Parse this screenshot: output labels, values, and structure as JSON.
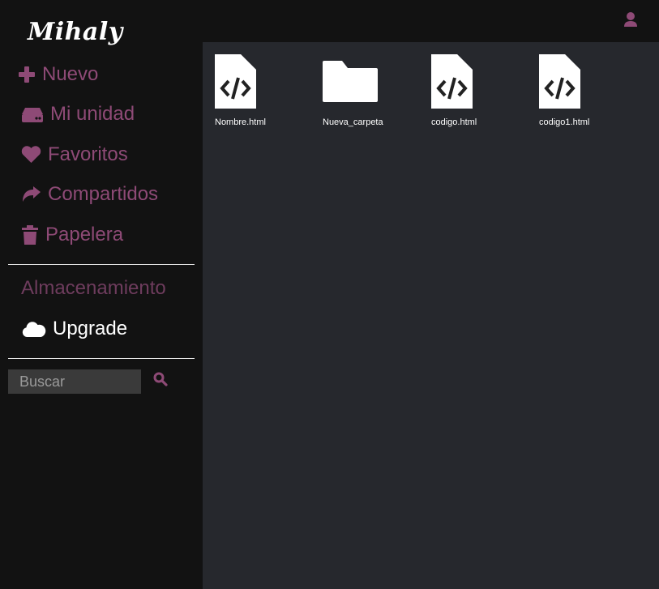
{
  "app": {
    "brand": "Mihaly"
  },
  "header": {
    "user_icon": "user-icon"
  },
  "sidebar": {
    "items": [
      {
        "label": "Nuevo",
        "icon": "plus-icon"
      },
      {
        "label": "Mi unidad",
        "icon": "hard-drive-icon"
      },
      {
        "label": "Favoritos",
        "icon": "heart-icon"
      },
      {
        "label": "Compartidos",
        "icon": "share-icon"
      },
      {
        "label": "Papelera",
        "icon": "trash-icon"
      }
    ],
    "storage_label": "Almacenamiento",
    "upgrade": {
      "label": "Upgrade",
      "icon": "cloud-icon"
    },
    "search": {
      "placeholder": "Buscar",
      "value": "",
      "icon": "search-icon"
    }
  },
  "files": [
    {
      "name": "Nombre.html",
      "type": "html-file-icon"
    },
    {
      "name": "Nueva_carpeta",
      "type": "folder-icon"
    },
    {
      "name": "codigo.html",
      "type": "html-file-icon"
    },
    {
      "name": "codigo1.html",
      "type": "html-file-icon"
    }
  ],
  "colors": {
    "sidebar_bg": "#121212",
    "main_bg": "#26282d",
    "accent": "#8e4a76",
    "accent_muted": "#6e3c5d",
    "text_white": "#ffffff"
  }
}
